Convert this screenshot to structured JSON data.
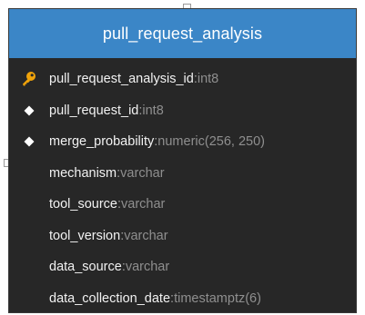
{
  "table": {
    "title": "pull_request_analysis",
    "columns": [
      {
        "name": "pull_request_analysis_id",
        "type": "int8",
        "marker": "key-icon"
      },
      {
        "name": "pull_request_id",
        "type": "int8",
        "marker": "diamond-icon"
      },
      {
        "name": "merge_probability",
        "type": "numeric(256, 250)",
        "marker": "diamond-icon"
      },
      {
        "name": "mechanism",
        "type": "varchar",
        "marker": ""
      },
      {
        "name": "tool_source",
        "type": "varchar",
        "marker": ""
      },
      {
        "name": "tool_version",
        "type": "varchar",
        "marker": ""
      },
      {
        "name": "data_source",
        "type": "varchar",
        "marker": ""
      },
      {
        "name": "data_collection_date",
        "type": "timestamptz(6)",
        "marker": ""
      }
    ],
    "separator": ": "
  },
  "colors": {
    "header": "#3b86c7",
    "body": "#272727",
    "key": "#f0a30a",
    "diamond": "#ffffff",
    "column_name": "#f2f2f2",
    "column_type": "#8f8f8f"
  }
}
